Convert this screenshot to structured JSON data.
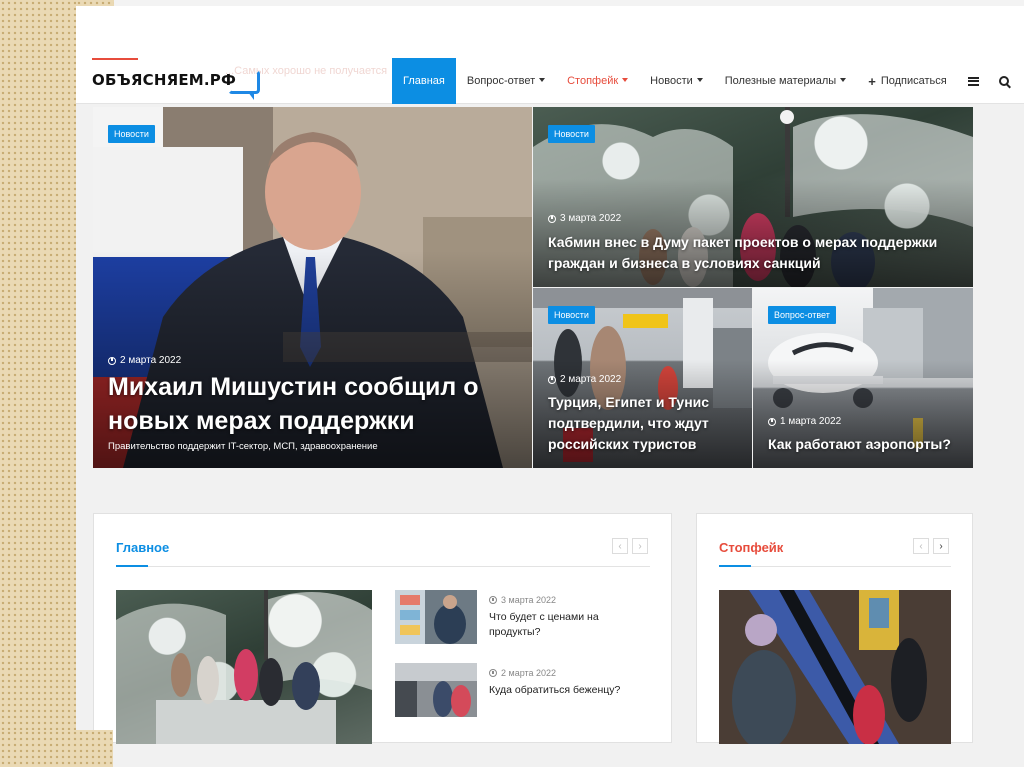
{
  "site": {
    "logo_text": "ОБЪЯСНЯЕМ.РФ",
    "ghost_text": "...Самых хорошо не получается"
  },
  "nav": {
    "items": [
      {
        "label": "Главная",
        "active": true,
        "caret": false
      },
      {
        "label": "Вопрос-ответ",
        "active": false,
        "caret": true
      },
      {
        "label": "Стопфейк",
        "active": false,
        "caret": true,
        "color": "#e74c3c"
      },
      {
        "label": "Новости",
        "active": false,
        "caret": true
      },
      {
        "label": "Полезные материалы",
        "active": false,
        "caret": true
      }
    ],
    "subscribe_label": "Подписаться"
  },
  "hero": {
    "main": {
      "tag": "Новости",
      "date": "2 марта 2022",
      "title": "Михаил Мишустин сообщил о новых мерах поддержки",
      "excerpt": "Правительство поддержит IT-сектор, МСП, здравоохранение"
    },
    "top_right": {
      "tag": "Новости",
      "date": "3 марта 2022",
      "title": "Кабмин внес в Думу пакет проектов о мерах поддержки граждан и бизнеса в условиях санкций"
    },
    "bottom_left": {
      "tag": "Новости",
      "date": "2 марта 2022",
      "title": "Турция, Египет и Тунис подтвердили, что ждут российских туристов"
    },
    "bottom_right": {
      "tag": "Вопрос-ответ",
      "date": "1 марта 2022",
      "title": "Как работают аэропорты?"
    }
  },
  "sections": {
    "main": {
      "title": "Главное",
      "accent": "#0c8ee3",
      "items": [
        {
          "date": "3 марта 2022",
          "title": "Что будет с ценами на продукты?"
        },
        {
          "date": "2 марта 2022",
          "title": "Куда обратиться беженцу?"
        }
      ]
    },
    "stopfake": {
      "title": "Стопфейк",
      "accent": "#e74c3c"
    }
  },
  "colors": {
    "brand_blue": "#0c8ee3",
    "accent_red": "#e74c3c"
  }
}
